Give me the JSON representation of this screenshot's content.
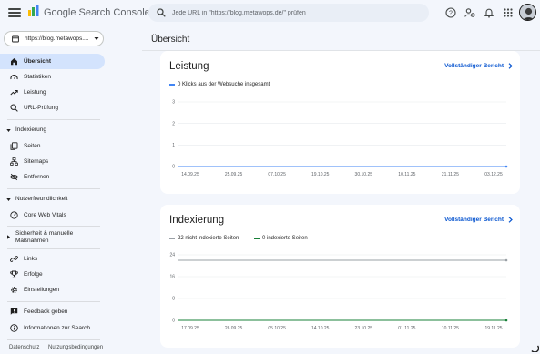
{
  "header": {
    "brand": "Google Search Console",
    "search_placeholder": "Jede URL in \"https://blog.metawops.de/\" prüfen",
    "icons": [
      "help-icon",
      "users-icon",
      "bell-icon",
      "apps-icon"
    ]
  },
  "sidebar": {
    "property": "https://blog.metawops.de/",
    "property_display": "https://blog.metawops....",
    "items_top": [
      {
        "label": "Übersicht",
        "icon": "home-icon",
        "active": true
      },
      {
        "label": "Statistiken",
        "icon": "speedometer-icon"
      },
      {
        "label": "Leistung",
        "icon": "trending-up-icon"
      },
      {
        "label": "URL-Prüfung",
        "icon": "search-icon"
      }
    ],
    "sections": [
      {
        "label": "Indexierung",
        "items": [
          {
            "label": "Seiten",
            "icon": "pages-icon"
          },
          {
            "label": "Sitemaps",
            "icon": "sitemap-icon"
          },
          {
            "label": "Entfernen",
            "icon": "eye-off-icon"
          }
        ]
      },
      {
        "label": "Nutzerfreundlichkeit",
        "items": [
          {
            "label": "Core Web Vitals",
            "icon": "gauge-icon"
          }
        ]
      },
      {
        "label": "Sicherheit & manuelle Maßnahmen",
        "label_line1": "Sicherheit & manuelle",
        "label_line2": "Maßnahmen",
        "items": []
      }
    ],
    "items_bottom": [
      {
        "label": "Links",
        "icon": "link-icon"
      },
      {
        "label": "Erfolge",
        "icon": "trophy-icon"
      },
      {
        "label": "Einstellungen",
        "icon": "gear-icon"
      }
    ],
    "items_support": [
      {
        "label": "Feedback geben",
        "icon": "feedback-icon"
      },
      {
        "label": "Informationen zur Search...",
        "icon": "info-icon"
      }
    ],
    "footer": [
      "Datenschutz",
      "Nutzungsbedingungen"
    ]
  },
  "main": {
    "title": "Übersicht",
    "cards": [
      {
        "title": "Leistung",
        "link": "Vollständiger Bericht",
        "legend": [
          "0 Klicks aus der Websuche insgesamt"
        ]
      },
      {
        "title": "Indexierung",
        "link": "Vollständiger Bericht",
        "legend": [
          "22 nicht indexierte Seiten",
          "0 indexierte Seiten"
        ]
      }
    ]
  },
  "colors": {
    "accent": "#0b57d0",
    "active_bg": "#d3e3fd",
    "clicks_series": "#4285f4",
    "not_indexed_series": "#9aa0a6",
    "indexed_series": "#188038"
  },
  "chart_data": [
    {
      "type": "line",
      "x": [
        "14.09.25",
        "25.09.25",
        "07.10.25",
        "19.10.25",
        "30.10.25",
        "10.11.25",
        "21.11.25",
        "03.12.25"
      ],
      "yticks": [
        0,
        1,
        2,
        3
      ],
      "ylim": [
        0,
        3
      ],
      "series": [
        {
          "name": "0 Klicks aus der Websuche insgesamt",
          "values": [
            0,
            0,
            0,
            0,
            0,
            0,
            0,
            0
          ]
        }
      ]
    },
    {
      "type": "line",
      "x": [
        "17.09.25",
        "26.09.25",
        "05.10.25",
        "14.10.25",
        "23.10.25",
        "01.11.25",
        "10.11.25",
        "19.11.25"
      ],
      "yticks": [
        0,
        8,
        16,
        24
      ],
      "ylim": [
        0,
        24
      ],
      "series": [
        {
          "name": "22 nicht indexierte Seiten",
          "values": [
            22,
            22,
            22,
            22,
            22,
            22,
            22,
            22
          ]
        },
        {
          "name": "0 indexierte Seiten",
          "values": [
            0,
            0,
            0,
            0,
            0,
            0,
            0,
            0
          ]
        }
      ]
    }
  ]
}
